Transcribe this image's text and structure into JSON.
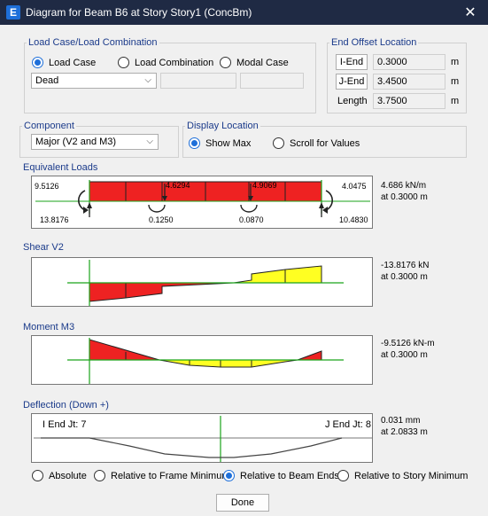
{
  "window": {
    "title": "Diagram for Beam B6 at Story Story1 (ConcBm)",
    "app_icon": "E",
    "close": "✕"
  },
  "load_case": {
    "legend": "Load Case/Load Combination",
    "options": [
      "Load Case",
      "Load Combination",
      "Modal Case"
    ],
    "selected": "Load Case",
    "value": "Dead"
  },
  "end_offset": {
    "legend": "End Offset Location",
    "iend_label": "I-End",
    "iend_value": "0.3000",
    "jend_label": "J-End",
    "jend_value": "3.4500",
    "length_label": "Length",
    "length_value": "3.7500",
    "unit": "m"
  },
  "component": {
    "legend": "Component",
    "value": "Major (V2 and M3)"
  },
  "display_location": {
    "legend": "Display Location",
    "options": [
      "Show Max",
      "Scroll for Values"
    ],
    "selected": "Show Max"
  },
  "equivalent_loads": {
    "label": "Equivalent Loads",
    "left_moment": "9.5126",
    "right_moment": "4.0475",
    "left_reaction": "13.8176",
    "right_reaction": "10.4830",
    "point1": "4.6294",
    "point2": "4.9069",
    "moment1": "0.1250",
    "moment2": "0.0870",
    "max_value": "4.686 kN/m",
    "max_loc": "at 0.3000 m"
  },
  "shear": {
    "label": "Shear V2",
    "max_value": "-13.8176 kN",
    "max_loc": "at 0.3000 m"
  },
  "moment": {
    "label": "Moment M3",
    "max_value": "-9.5126 kN-m",
    "max_loc": "at 0.3000 m"
  },
  "deflection": {
    "label": "Deflection (Down +)",
    "i_label": "I End Jt: 7",
    "j_label": "J End Jt: 8",
    "max_value": "0.031 mm",
    "max_loc": "at 2.0833 m",
    "options": [
      "Absolute",
      "Relative to Frame Minimum",
      "Relative to Beam Ends",
      "Relative to Story Minimum"
    ],
    "selected": "Relative to Beam Ends"
  },
  "colors": {
    "load_red": "#ee2222",
    "pos_yellow": "#ffff22",
    "axis_green": "#1aa31a",
    "legend_blue": "#1a3a8a",
    "title_bar": "#1f2a44"
  },
  "done_label": "Done"
}
